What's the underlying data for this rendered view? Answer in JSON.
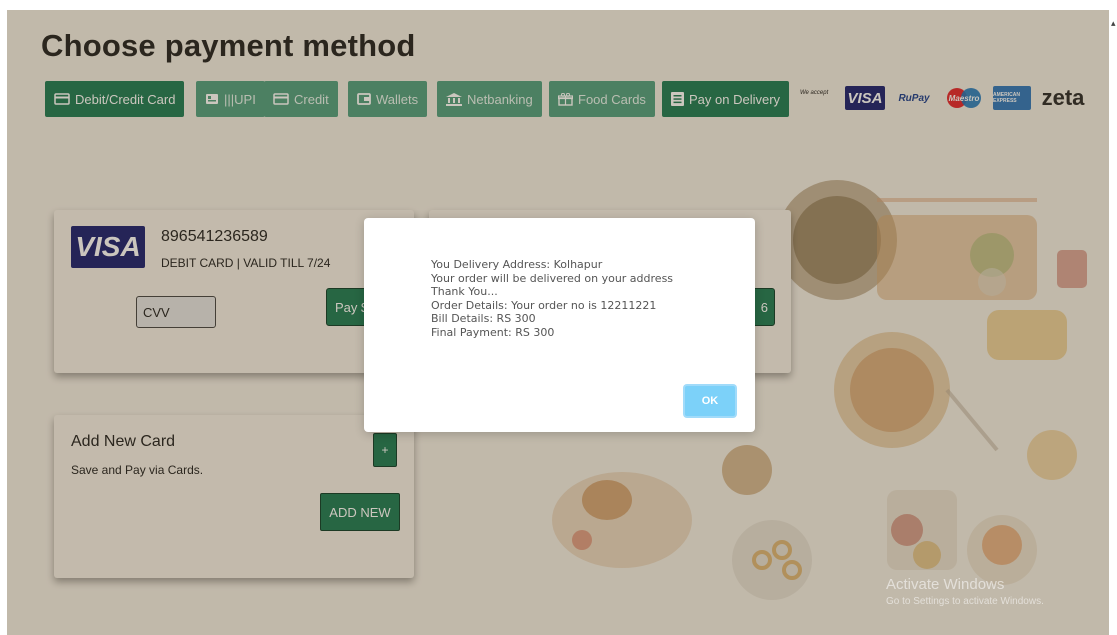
{
  "page": {
    "title": "Choose payment method"
  },
  "tabs": [
    {
      "label": "Debit/Credit Card",
      "icon": "card-icon",
      "active": true
    },
    {
      "label": "|||UPI",
      "icon": "upi-icon",
      "active": false
    },
    {
      "label": "Credit",
      "icon": "card-icon",
      "active": false
    },
    {
      "label": "Wallets",
      "icon": "wallet-icon",
      "active": false
    },
    {
      "label": "Netbanking",
      "icon": "bank-icon",
      "active": false
    },
    {
      "label": "Food Cards",
      "icon": "gift-icon",
      "active": false
    },
    {
      "label": "Pay on Delivery",
      "icon": "receipt-icon",
      "active": true
    }
  ],
  "accepted": {
    "label": "We accept",
    "logos": [
      "VISA",
      "RuPay",
      "Maestro",
      "AMERICAN EXPRESS",
      "zeta"
    ]
  },
  "saved_card": {
    "brand": "VISA",
    "number": "896541236589",
    "meta": "DEBIT CARD | VALID TILL 7/24",
    "cvv_placeholder": "CVV",
    "pay_label": "Pay $",
    "pay_label_2": "6"
  },
  "add_card": {
    "title": "Add New Card",
    "subtitle": "Save and Pay via Cards.",
    "plus_label": "+",
    "button_label": "ADD NEW"
  },
  "modal": {
    "lines": [
      "You Delivery Address: Kolhapur",
      "Your order will be delivered on your address",
      "Thank You...",
      "Order Details: Your order no is 12211221",
      "Bill Details: RS 300",
      "Final Payment: RS 300"
    ],
    "ok_label": "OK"
  },
  "watermark": {
    "line1": "Activate Windows",
    "line2": "Go to Settings to activate Windows."
  },
  "colors": {
    "primary": "#1d7a55",
    "page_bg": "#f2ede4",
    "ok_button": "#7cd1f9",
    "visa": "#1a1f71"
  }
}
